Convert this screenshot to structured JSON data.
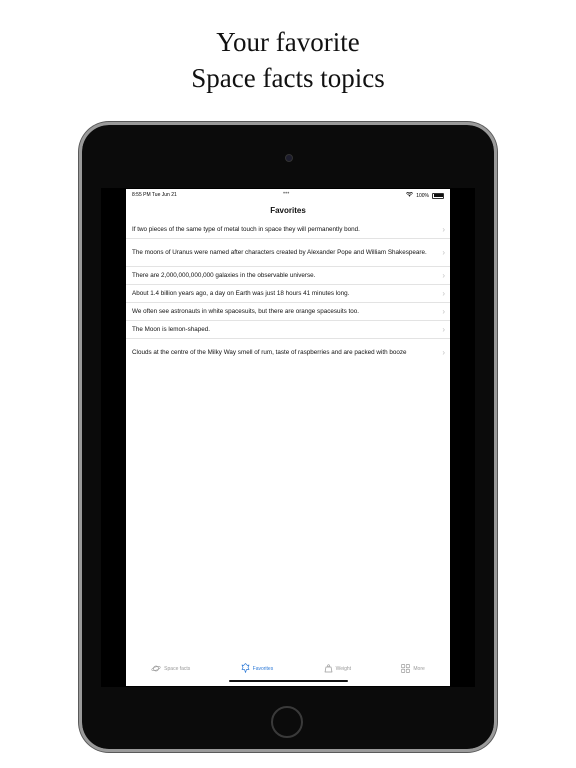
{
  "headline": {
    "line1": "Your favorite",
    "line2": "Space facts topics"
  },
  "status_bar": {
    "time": "8:55 PM  Tue Jun 21",
    "battery": "100%"
  },
  "nav": {
    "title": "Favorites"
  },
  "favorites": [
    "If two pieces of the same type of metal touch in space they will permanently bond.",
    "The moons of Uranus were named after characters created by Alexander Pope and William Shakespeare.",
    "There are 2,000,000,000,000 galaxies in the observable universe.",
    "About 1.4 billion years ago, a day on Earth was just 18 hours 41 minutes long.",
    "We often see astronauts in white spacesuits, but there are orange spacesuits too.",
    "The Moon is lemon-shaped.",
    "Clouds at the centre of the Milky Way smell of rum, taste of raspberries and are packed with booze"
  ],
  "tabs": {
    "space_facts": {
      "label": "Space facts",
      "icon": "planet-icon"
    },
    "favorites": {
      "label": "Favorites",
      "icon": "favorites-icon"
    },
    "weight": {
      "label": "Weight",
      "icon": "weight-icon"
    },
    "more": {
      "label": "More",
      "icon": "grid-icon"
    }
  },
  "colors": {
    "accent": "#2f7bd8",
    "inactive_tab": "#9a9a9a"
  }
}
